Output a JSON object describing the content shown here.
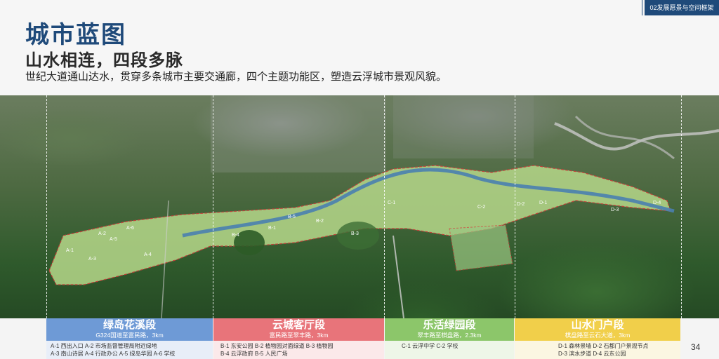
{
  "header": {
    "section_tab": "02发展愿景与空间框架",
    "title": "城市蓝图",
    "subtitle": "山水相连，四段多脉",
    "description": "世纪大道通山达水，贯穿多条城市主要交通廊，四个主题功能区，塑造云浮城市景观风貌。"
  },
  "map_labels": [
    "A-1",
    "A-2",
    "A-3",
    "A-4",
    "A-5",
    "A-6",
    "B-1",
    "B-2",
    "B-3",
    "B-4",
    "B-5",
    "C-1",
    "C-2",
    "D-1",
    "D-2",
    "D-3",
    "D-4"
  ],
  "segments": [
    {
      "name": "绿岛花溪段",
      "route": "G324国道至富民路，3km",
      "color": "#6e9ad6",
      "body_color": "#e8eef8",
      "items_line1": "A-1  西出入口    A-2  市场监督管理局附近绿地",
      "items_line2": "A-3  南山诗居    A-4  行政办公    A-5  绿岛华园    A-6  学校"
    },
    {
      "name": "云城客厅段",
      "route": "富民路至翠丰路，3km",
      "color": "#e8747a",
      "body_color": "#fbe9ea",
      "items_line1": "B-1  东安公园    B-2  植物园对面绿道    B-3  植物园",
      "items_line2": "B-4  云浮政府    B-5  人民广场"
    },
    {
      "name": "乐活绿园段",
      "route": "翠丰路至棋盘路，2.3km",
      "color": "#8cc66a",
      "body_color": "#eef6e8",
      "items_line1": "C-1  云浮中学    C-2  学校",
      "items_line2": ""
    },
    {
      "name": "山水门户段",
      "route": "棋盘路至云石大道，3km",
      "color": "#f1cf4a",
      "body_color": "#fbf6e2",
      "items_line1": "D-1  森林景墙    D-2  石都门户景观节点",
      "items_line2": "D-3  滨水步道    D-4  云东公园"
    }
  ],
  "page_number": "34"
}
